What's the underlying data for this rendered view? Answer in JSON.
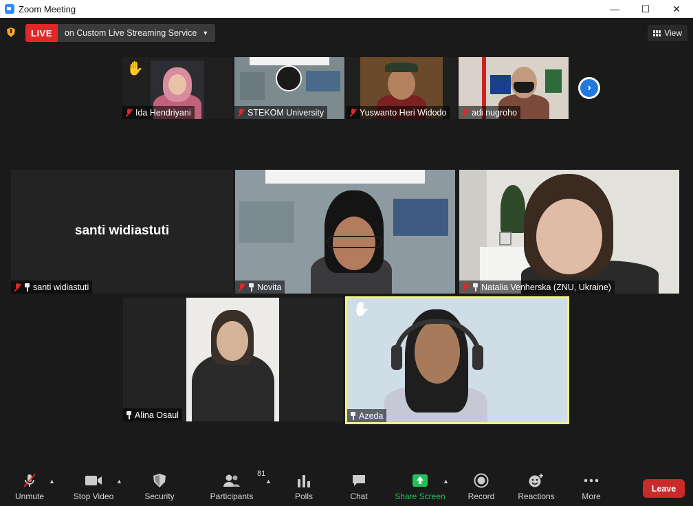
{
  "window": {
    "title": "Zoom Meeting",
    "minimize": "—",
    "maximize": "☐",
    "close": "✕"
  },
  "topbar": {
    "live_label": "LIVE",
    "stream_text": "on Custom Live Streaming Service",
    "view_label": "View"
  },
  "strip": [
    {
      "name": "Ida Hendriyani",
      "muted": true,
      "hand": true
    },
    {
      "name": "STEKOM University",
      "muted": true
    },
    {
      "name": "Yuswanto Heri Widodo",
      "muted": true
    },
    {
      "name": "adi nugroho",
      "muted": true
    }
  ],
  "grid": [
    {
      "name": "santi widiastuti",
      "display_name": "santi widiastuti",
      "muted": true,
      "pinned": true
    },
    {
      "name": "Novita",
      "muted": true,
      "pinned": true
    },
    {
      "name": "Natalia Venherska (ZNU, Ukraine)",
      "muted": true,
      "pinned": true
    },
    {
      "name": "Alina Osaul",
      "pinned": true
    },
    {
      "name": "Azeda",
      "pinned": true,
      "hand": true,
      "active_speaker": true
    }
  ],
  "toolbar": {
    "unmute": "Unmute",
    "stop_video": "Stop Video",
    "security": "Security",
    "participants": "Participants",
    "participants_count": "81",
    "polls": "Polls",
    "chat": "Chat",
    "share_screen": "Share Screen",
    "record": "Record",
    "reactions": "Reactions",
    "more": "More",
    "leave": "Leave"
  },
  "colors": {
    "live_red": "#e02828",
    "active_speaker_border": "#f2f28a",
    "share_green": "#21c15a",
    "leave_red": "#c92a2a",
    "next_blue": "#1f7ae0"
  }
}
